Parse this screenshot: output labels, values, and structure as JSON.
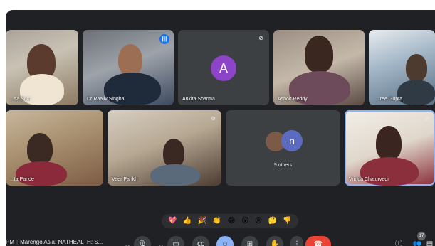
{
  "participants": [
    {
      "name": "...sa Soin",
      "muted": false
    },
    {
      "name": "Dr Raajiv Singhal",
      "speaking": true
    },
    {
      "name": "Ankita Sharma",
      "initial": "A",
      "muted": true,
      "avatar_color": "#8e44c9"
    },
    {
      "name": "Ashok Reddy",
      "muted": false
    },
    {
      "name": "...ree Gupta",
      "muted": false
    },
    {
      "name": "...ta Pande",
      "muted": false
    },
    {
      "name": "Veer Parikh",
      "muted": true
    },
    {
      "name": "9 others",
      "initial": "n",
      "avatar_color": "#5c6bc0"
    },
    {
      "name": "Vrinda Chaturvedi",
      "muted": true,
      "active": true
    }
  ],
  "reactions": [
    "💖",
    "👍",
    "🎉",
    "👏",
    "😂",
    "😮",
    "😢",
    "🤔",
    "👎"
  ],
  "meeting": {
    "time_fragment": "PM",
    "title": "Marengo Asia: NATHEALTH: S..."
  },
  "controls": {
    "people_count": "17"
  },
  "icons": {
    "mic": "microphone-icon",
    "camera": "camera-icon",
    "captions": "captions-icon",
    "emoji": "emoji-icon",
    "present": "present-icon",
    "hand": "raise-hand-icon",
    "more": "more-vert-icon",
    "end": "end-call-icon",
    "info": "info-icon",
    "people": "people-icon",
    "chat": "chat-icon"
  },
  "colors": {
    "meet_bg": "#202124",
    "accent_blue": "#8ab4f8",
    "end_red": "#ea4335"
  }
}
